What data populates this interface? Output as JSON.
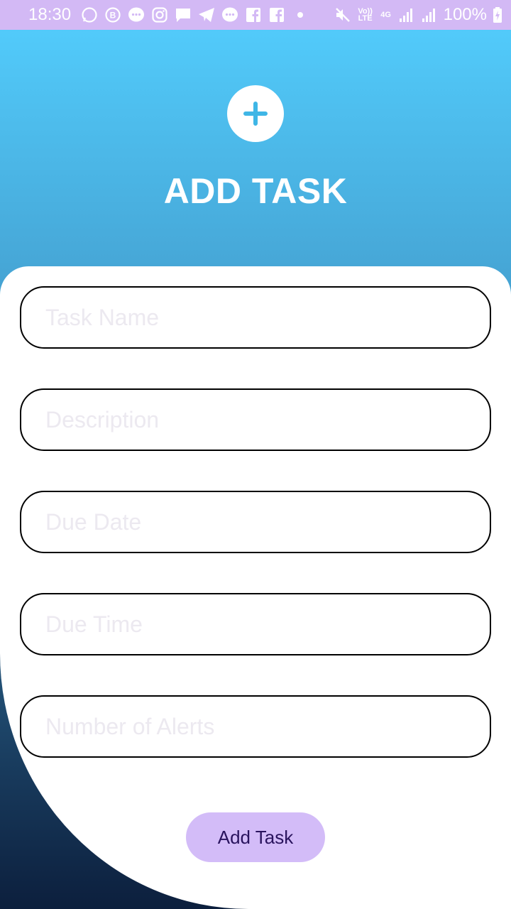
{
  "status_bar": {
    "time": "18:30",
    "notification_icons": [
      "whatsapp-icon",
      "b-messenger-icon",
      "messenger-icon",
      "instagram-icon",
      "chat-icon",
      "telegram-icon",
      "messenger-icon",
      "facebook-icon",
      "facebook-icon",
      "dot-icon"
    ],
    "volte_label": "Vo)) LTE",
    "network_label": "4G",
    "battery": "100%"
  },
  "header": {
    "icon": "plus-circle-icon",
    "title": "ADD TASK"
  },
  "form": {
    "fields": [
      {
        "placeholder": "Task Name",
        "value": ""
      },
      {
        "placeholder": "Description",
        "value": ""
      },
      {
        "placeholder": "Due Date",
        "value": ""
      },
      {
        "placeholder": "Due Time",
        "value": ""
      },
      {
        "placeholder": "Number of Alerts",
        "value": ""
      }
    ],
    "submit_label": "Add Task"
  },
  "colors": {
    "status_bar": "#d3b9f5",
    "gradient_top": "#53cfff",
    "gradient_bottom": "#0c1f3d",
    "accent": "#3fb6e6",
    "button": "#d3bcf8",
    "button_text": "#2a145e"
  }
}
